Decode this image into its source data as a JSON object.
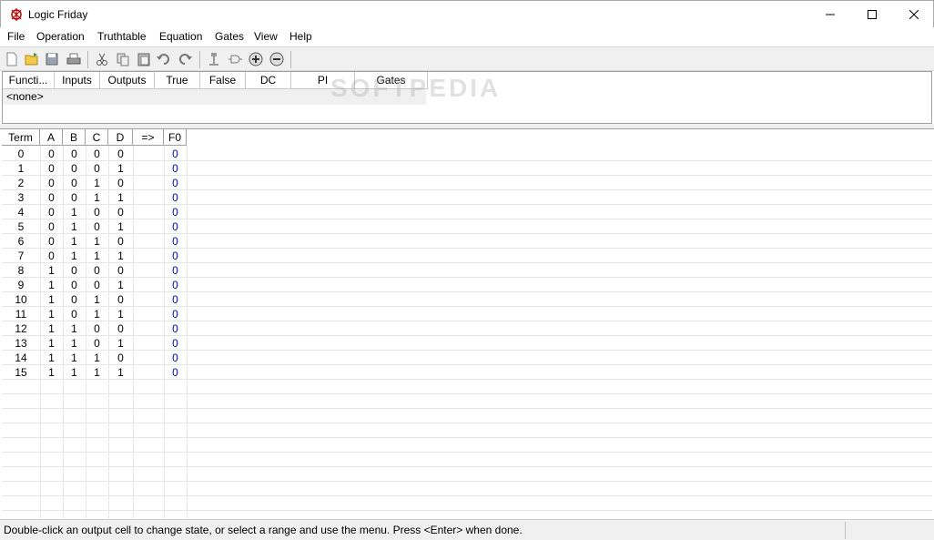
{
  "window": {
    "title": "Logic Friday",
    "icon": "logic-friday-app-icon",
    "controls": [
      "minimize-icon",
      "maximize-icon",
      "close-icon"
    ]
  },
  "menu": [
    "File",
    "Operation",
    "Truthtable",
    "Equation",
    "Gates",
    "View",
    "Help"
  ],
  "toolbar": [
    "new-file-icon",
    "open-folder-icon",
    "save-icon",
    "print-icon",
    "cut-icon",
    "copy-icon",
    "paste-icon",
    "undo-icon",
    "redo-icon",
    "minimize-logic-icon",
    "gate-icon",
    "add-icon",
    "remove-icon"
  ],
  "functions": {
    "columns": [
      "Functi...",
      "Inputs",
      "Outputs",
      "True",
      "False",
      "DC",
      "PI",
      "Gates"
    ],
    "rows": [
      "<none>"
    ],
    "watermark": "SOFTPEDIA"
  },
  "truthtable": {
    "columns": [
      "Term",
      "A",
      "B",
      "C",
      "D",
      "=>",
      "F0"
    ],
    "rows": [
      [
        "0",
        "0",
        "0",
        "0",
        "0",
        "",
        "0"
      ],
      [
        "1",
        "0",
        "0",
        "0",
        "1",
        "",
        "0"
      ],
      [
        "2",
        "0",
        "0",
        "1",
        "0",
        "",
        "0"
      ],
      [
        "3",
        "0",
        "0",
        "1",
        "1",
        "",
        "0"
      ],
      [
        "4",
        "0",
        "1",
        "0",
        "0",
        "",
        "0"
      ],
      [
        "5",
        "0",
        "1",
        "0",
        "1",
        "",
        "0"
      ],
      [
        "6",
        "0",
        "1",
        "1",
        "0",
        "",
        "0"
      ],
      [
        "7",
        "0",
        "1",
        "1",
        "1",
        "",
        "0"
      ],
      [
        "8",
        "1",
        "0",
        "0",
        "0",
        "",
        "0"
      ],
      [
        "9",
        "1",
        "0",
        "0",
        "1",
        "",
        "0"
      ],
      [
        "10",
        "1",
        "0",
        "1",
        "0",
        "",
        "0"
      ],
      [
        "11",
        "1",
        "0",
        "1",
        "1",
        "",
        "0"
      ],
      [
        "12",
        "1",
        "1",
        "0",
        "0",
        "",
        "0"
      ],
      [
        "13",
        "1",
        "1",
        "0",
        "1",
        "",
        "0"
      ],
      [
        "14",
        "1",
        "1",
        "1",
        "0",
        "",
        "0"
      ],
      [
        "15",
        "1",
        "1",
        "1",
        "1",
        "",
        "0"
      ]
    ],
    "output_color": "#0000c8"
  },
  "status": {
    "message": "Double-click an output cell to change state, or select a range and use the menu. Press <Enter> when done."
  }
}
